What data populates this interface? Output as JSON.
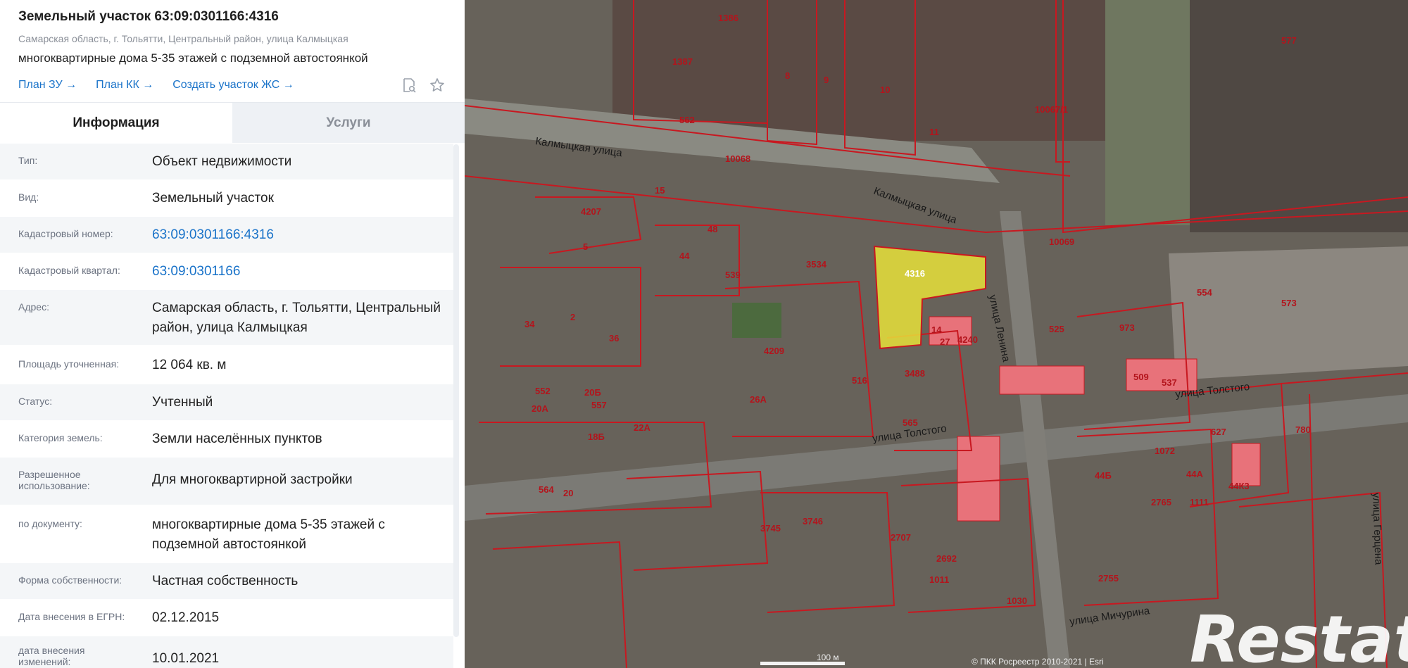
{
  "header": {
    "title": "Земельный участок 63:09:0301166:4316",
    "address": "Самарская область, г. Тольятти, Центральный район, улица Калмыцкая",
    "purpose": "многоквартирные дома 5-35 этажей с подземной автостоянкой",
    "links": [
      "План ЗУ →",
      "План КК →",
      "Создать участок ЖС →"
    ],
    "icons": [
      "search-document-icon",
      "star-icon"
    ]
  },
  "tabs": [
    {
      "label": "Информация",
      "active": true
    },
    {
      "label": "Услуги",
      "active": false
    }
  ],
  "info": [
    {
      "label": "Тип:",
      "value": "Объект недвижимости",
      "link": false
    },
    {
      "label": "Вид:",
      "value": "Земельный участок",
      "link": false
    },
    {
      "label": "Кадастровый номер:",
      "value": "63:09:0301166:4316",
      "link": true
    },
    {
      "label": "Кадастровый квартал:",
      "value": "63:09:0301166",
      "link": true
    },
    {
      "label": "Адрес:",
      "value": "Самарская область, г. Тольятти, Центральный район, улица Калмыцкая",
      "link": false
    },
    {
      "label": "Площадь уточненная:",
      "value": "12 064 кв. м",
      "link": false
    },
    {
      "label": "Статус:",
      "value": "Учтенный",
      "link": false
    },
    {
      "label": "Категория земель:",
      "value": "Земли населённых пунктов",
      "link": false
    },
    {
      "label": "Разрешенное использование:",
      "value": "Для многоквартирной застройки",
      "link": false
    },
    {
      "label": "по документу:",
      "value": "многоквартирные дома 5-35 этажей с подземной автостоянкой",
      "link": false
    },
    {
      "label": "Форма собственности:",
      "value": "Частная собственность",
      "link": false
    },
    {
      "label": "Дата внесения в ЕГРН:",
      "value": "02.12.2015",
      "link": false
    },
    {
      "label": "дата внесения изменений:",
      "value": "10.01.2021",
      "link": false
    }
  ],
  "map": {
    "streets": [
      "Калмыцкая улица",
      "Калмыцкая улица",
      "улица Ленина",
      "улица Толстого",
      "улица Толстого",
      "улица Мичурина",
      "улица Герцена"
    ],
    "selected_parcel": "4316",
    "parcels": [
      "1386",
      "577",
      "1387",
      "8",
      "9",
      "10",
      "10067/1",
      "562",
      "11",
      "10068",
      "15",
      "4207",
      "48",
      "5",
      "44",
      "539",
      "3534",
      "10069",
      "2",
      "34",
      "36",
      "4209",
      "4240",
      "14",
      "27",
      "525",
      "973",
      "554",
      "573",
      "3488",
      "516",
      "565",
      "509",
      "537",
      "552",
      "557",
      "20Б",
      "20А",
      "26А",
      "18Б",
      "22А",
      "780",
      "627",
      "1072",
      "44Б",
      "2765",
      "1111",
      "44А",
      "564",
      "20",
      "3746",
      "3745",
      "2707",
      "2692",
      "1011",
      "1030",
      "2755",
      "44К3"
    ],
    "scale": "100 м",
    "attribution": "© ПКК Росреестр 2010-2021 | Esri",
    "watermark": "Restate",
    "colors": {
      "parcel_border": "#c81820",
      "selected_fill": "#e8e23a",
      "building": "#e8727a"
    }
  }
}
